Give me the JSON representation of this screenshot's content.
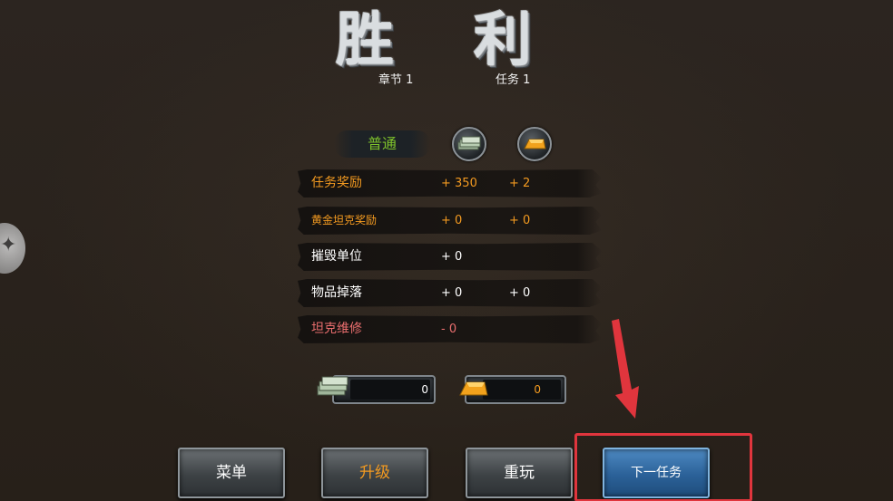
{
  "title": {
    "left_char": "胜",
    "right_char": "利"
  },
  "chapter_label": "章节 1",
  "mission_label": "任务 1",
  "difficulty": "普通",
  "icons": {
    "cash": "cash-stack-icon",
    "gold": "gold-bar-icon"
  },
  "rewards": [
    {
      "label": "任务奖励",
      "cash": "+ 350",
      "gold": "+ 2",
      "color": "#f39a20"
    },
    {
      "label": "黄金坦克奖励",
      "cash": "+ 0",
      "gold": "+ 0",
      "color": "#f39a20"
    },
    {
      "label": "摧毁单位",
      "cash": "+ 0",
      "gold": "",
      "color": "#ffffff"
    },
    {
      "label": "物品掉落",
      "cash": "+ 0",
      "gold": "+ 0",
      "color": "#ffffff"
    },
    {
      "label": "坦克维修",
      "cash": "- 0",
      "gold": "",
      "color": "#e96e6e"
    }
  ],
  "totals": {
    "cash": "0",
    "gold": "0"
  },
  "buttons": {
    "menu": "菜单",
    "upgrade": "升级",
    "replay": "重玩",
    "next": "下一任务"
  },
  "colors": {
    "accent_orange": "#f39a20",
    "difficulty_green": "#7ec22b",
    "highlight_red": "#e0353d",
    "next_button_blue": "#2b6198"
  }
}
